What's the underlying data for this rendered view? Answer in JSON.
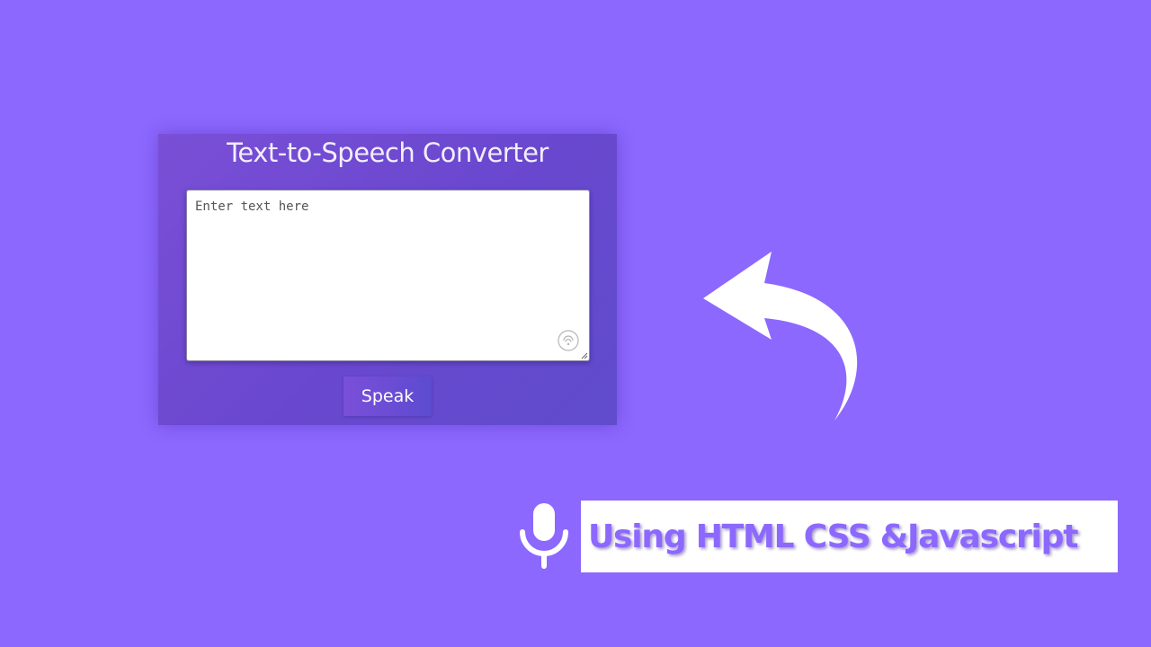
{
  "app": {
    "title": "Text-to-Speech Converter"
  },
  "input": {
    "placeholder": "Enter text here",
    "value": ""
  },
  "actions": {
    "speak_label": "Speak"
  },
  "banner": {
    "text": "Using HTML CSS &Javascript"
  },
  "icons": {
    "arrow": "curved-arrow-icon",
    "mic_inside": "microphone-icon",
    "mic_banner": "microphone-icon"
  },
  "colors": {
    "background": "#8c68ff",
    "card_start": "#7a4fd6",
    "card_end": "#5f4ccc",
    "banner_bg": "#ffffff",
    "banner_text": "#8c68ff"
  }
}
